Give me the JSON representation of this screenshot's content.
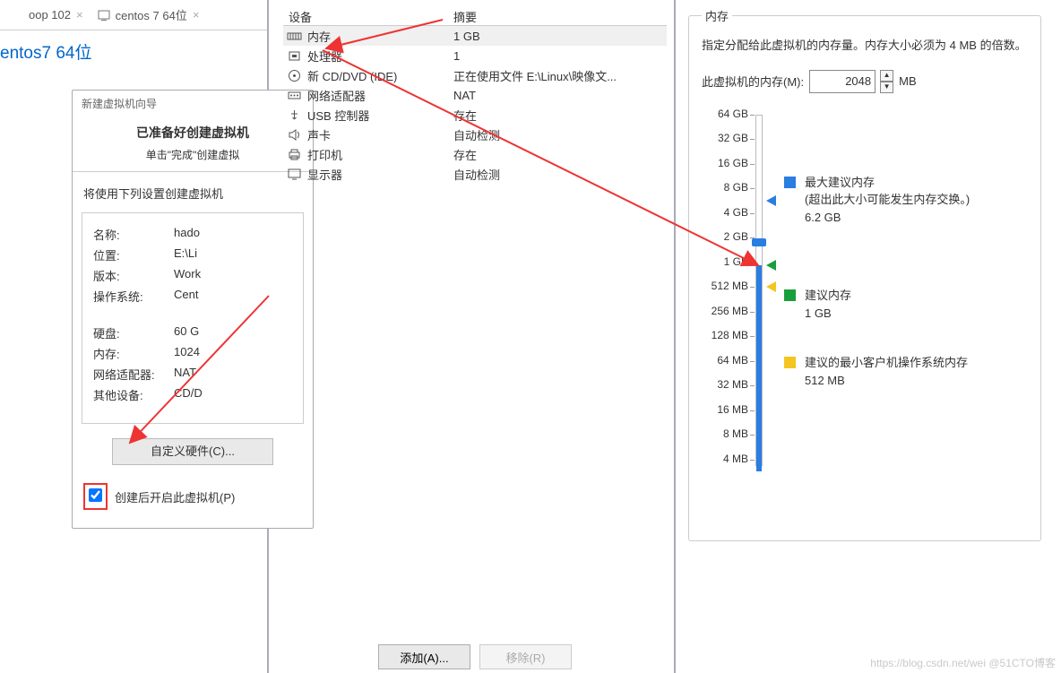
{
  "tabs": [
    {
      "label": "oop 102"
    },
    {
      "label": "centos 7 64位"
    }
  ],
  "heading": "entos7 64位",
  "wizard": {
    "window_title": "新建虚拟机向导",
    "title": "已准备好创建虚拟机",
    "subtitle": "单击\"完成\"创建虚拟",
    "msg": "将使用下列设置创建虚拟机",
    "rows1": [
      {
        "lbl": "名称:",
        "val": "hado"
      },
      {
        "lbl": "位置:",
        "val": "E:\\Li"
      },
      {
        "lbl": "版本:",
        "val": "Work"
      },
      {
        "lbl": "操作系统:",
        "val": "Cent"
      }
    ],
    "rows2": [
      {
        "lbl": "硬盘:",
        "val": "60 G"
      },
      {
        "lbl": "内存:",
        "val": "1024"
      },
      {
        "lbl": "网络适配器:",
        "val": "NAT"
      },
      {
        "lbl": "其他设备:",
        "val": "CD/D"
      }
    ],
    "btn": "自定义硬件(C)...",
    "chk": "创建后开启此虚拟机(P)"
  },
  "hw": {
    "col1": "设备",
    "col2": "摘要",
    "rows": [
      {
        "icon": "memory",
        "label": "内存",
        "summary": "1 GB",
        "sel": true
      },
      {
        "icon": "cpu",
        "label": "处理器",
        "summary": "1"
      },
      {
        "icon": "disc",
        "label": "新 CD/DVD (IDE)",
        "summary": "正在使用文件 E:\\Linux\\映像文..."
      },
      {
        "icon": "net",
        "label": "网络适配器",
        "summary": "NAT"
      },
      {
        "icon": "usb",
        "label": "USB 控制器",
        "summary": "存在"
      },
      {
        "icon": "sound",
        "label": "声卡",
        "summary": "自动检测"
      },
      {
        "icon": "printer",
        "label": "打印机",
        "summary": "存在"
      },
      {
        "icon": "display",
        "label": "显示器",
        "summary": "自动检测"
      }
    ],
    "add": "添加(A)...",
    "remove": "移除(R)"
  },
  "mem": {
    "legend": "内存",
    "info": "指定分配给此虚拟机的内存量。内存大小必须为 4 MB 的倍数。",
    "field": "此虚拟机的内存(M):",
    "value": "2048",
    "unit": "MB",
    "ticks": [
      "64 GB",
      "32 GB",
      "16 GB",
      "8 GB",
      "4 GB",
      "2 GB",
      "1 GB",
      "512 MB",
      "256 MB",
      "128 MB",
      "64 MB",
      "32 MB",
      "16 MB",
      "8 MB",
      "4 MB"
    ],
    "leg_max_t": "最大建议内存",
    "leg_max_s": "(超出此大小可能发生内存交换。)",
    "leg_max_v": "6.2 GB",
    "leg_rec_t": "建议内存",
    "leg_rec_v": "1 GB",
    "leg_min_t": "建议的最小客户机操作系统内存",
    "leg_min_v": "512 MB"
  },
  "watermark": "https://blog.csdn.net/wei   @51CTO博客"
}
